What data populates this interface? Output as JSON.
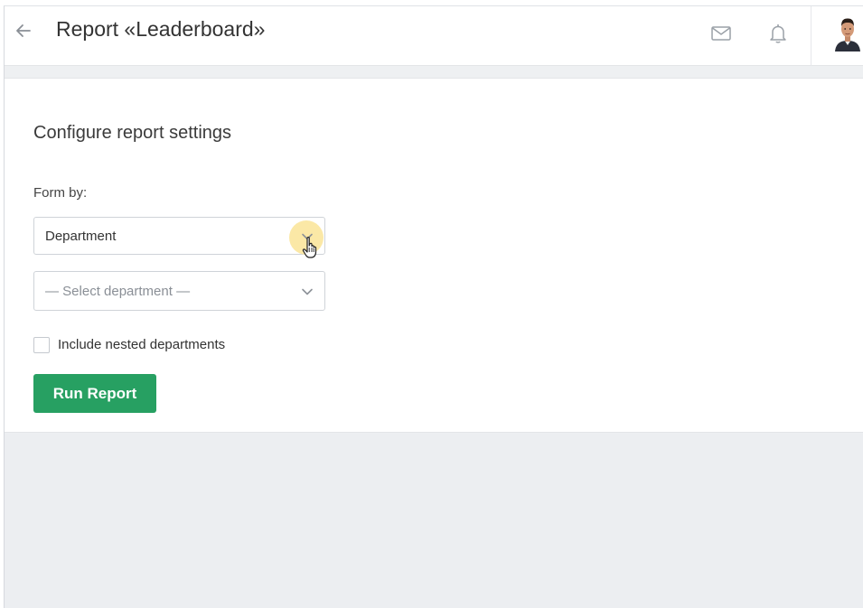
{
  "header": {
    "title": "Report «Leaderboard»",
    "back_icon": "arrow-left-icon",
    "mail_icon": "mail-icon",
    "bell_icon": "bell-icon",
    "avatar": "user-avatar"
  },
  "settings": {
    "section_title": "Configure report settings",
    "form_by_label": "Form by:",
    "form_by_value": "Department",
    "department_placeholder": "— Select department —",
    "include_nested_label": "Include nested departments",
    "include_nested_checked": false,
    "run_button": "Run Report"
  },
  "colors": {
    "accent": "#27a062",
    "highlight": "#fbe59c",
    "background": "#eceef1"
  }
}
